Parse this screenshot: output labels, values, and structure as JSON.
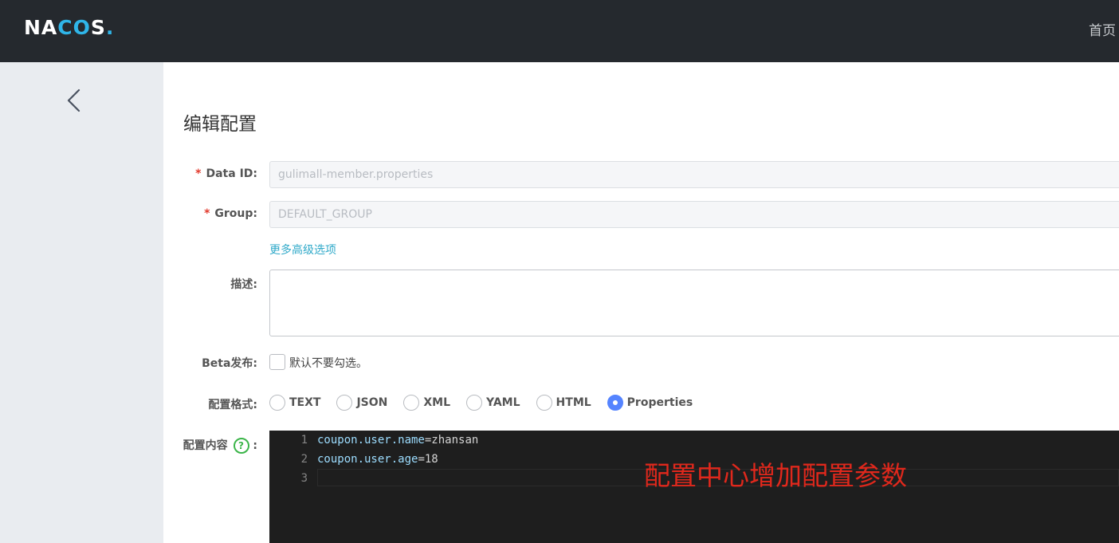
{
  "header": {
    "logo": {
      "part1": "NA",
      "part2": "CO",
      "part3": "S",
      "dot": "."
    },
    "nav_home": "首页"
  },
  "page": {
    "title": "编辑配置"
  },
  "form": {
    "data_id": {
      "required_mark": "*",
      "label": "Data ID:",
      "value": "gulimall-member.properties"
    },
    "group": {
      "required_mark": "*",
      "label": "Group:",
      "value": "DEFAULT_GROUP"
    },
    "more_options_link": "更多高级选项",
    "description": {
      "label": "描述:",
      "value": ""
    },
    "beta": {
      "label": "Beta发布:",
      "checkbox_text": "默认不要勾选。",
      "checked": false
    },
    "format": {
      "label": "配置格式:",
      "options": [
        "TEXT",
        "JSON",
        "XML",
        "YAML",
        "HTML",
        "Properties"
      ],
      "selected": "Properties"
    },
    "content": {
      "label": "配置内容",
      "help_icon": "?",
      "colon": ":",
      "lines": [
        {
          "num": "1",
          "key": "coupon.user.name",
          "eq": "=",
          "value": "zhansan"
        },
        {
          "num": "2",
          "key": "coupon.user.age",
          "eq": "=",
          "value": "18"
        },
        {
          "num": "3",
          "key": "",
          "eq": "",
          "value": ""
        }
      ]
    }
  },
  "annotation": "配置中心增加配置参数",
  "colors": {
    "topbar": "#25292e",
    "sidebar": "#e9ecf0",
    "accent": "#5584ff",
    "link": "#2fa9c9",
    "required": "#e23b2e",
    "annotation": "#e0281c",
    "editor_bg": "#1e1e1e"
  },
  "icons": {
    "back": "chevron-left-icon",
    "help": "question-circle-icon"
  }
}
